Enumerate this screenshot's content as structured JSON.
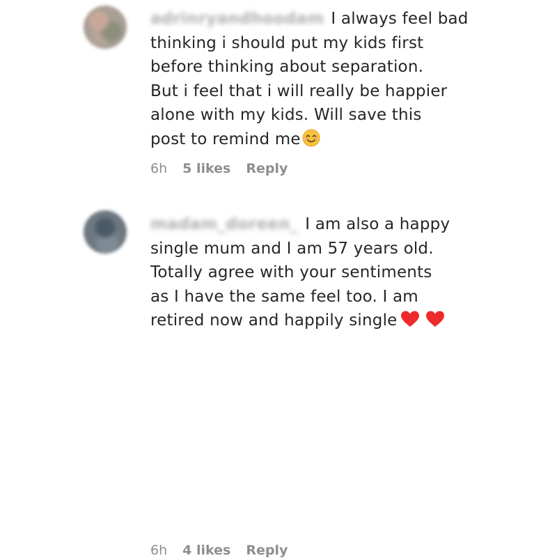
{
  "comments": [
    {
      "username": "adrinryandhoodam",
      "lines": [
        "I always feel bad",
        "thinking i should put my kids first",
        "before thinking about separation.",
        "But i feel that i will really be happier",
        "alone with my kids. Will save this",
        "post to remind me"
      ],
      "emoji": "smiling-face-icon",
      "time": "6h",
      "likes": "5 likes",
      "reply": "Reply"
    },
    {
      "username": "madam_doreen_",
      "lines": [
        "I am also a happy",
        "single mum and I am 57 years old.",
        "Totally agree with your sentiments",
        "as I have the same feel too. I am",
        "retired now and happily single"
      ],
      "emoji": "heart-icon",
      "time": "6h",
      "likes": "4 likes",
      "reply": "Reply"
    }
  ],
  "colors": {
    "text": "#262626",
    "meta": "#8e8e8e",
    "heart": "#ed2b2b",
    "emoji_face": "#f7c23c"
  }
}
